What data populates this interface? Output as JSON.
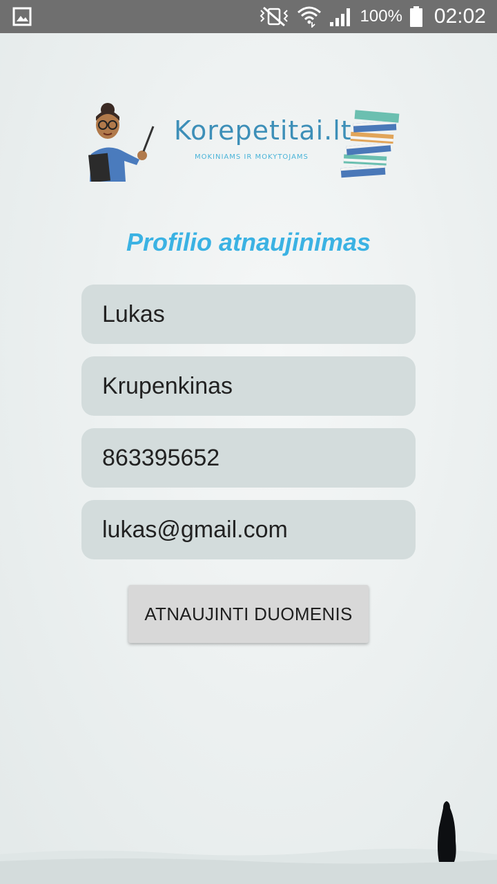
{
  "status_bar": {
    "battery_text": "100%",
    "time": "02:02",
    "icons": [
      "gallery-icon",
      "vibrate-icon",
      "wifi-icon",
      "signal-icon",
      "battery-icon"
    ]
  },
  "brand": {
    "name": "Korepetitai.lt",
    "tagline": "MOKINIAMS IR MOKYTOJAMS",
    "color": "#3d8fb8",
    "tagline_color": "#48b3d8"
  },
  "page": {
    "title": "Profilio atnaujinimas",
    "title_color": "#3bb2e3"
  },
  "form": {
    "first_name": "Lukas",
    "last_name": "Krupenkinas",
    "phone": "863395652",
    "email": "lukas@gmail.com",
    "field_bg": "#d3dcdc"
  },
  "actions": {
    "update_label": "ATNAUJINTI DUOMENIS"
  }
}
